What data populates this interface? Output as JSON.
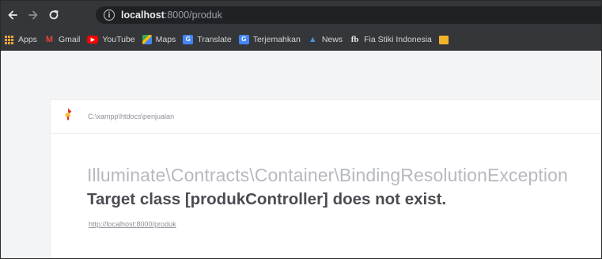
{
  "browser": {
    "url_host": "localhost",
    "url_rest": ":8000/produk",
    "bookmarks": [
      {
        "label": "Apps",
        "icon": "apps-grid-icon"
      },
      {
        "label": "Gmail",
        "icon": "gmail-icon"
      },
      {
        "label": "YouTube",
        "icon": "youtube-icon"
      },
      {
        "label": "Maps",
        "icon": "maps-icon"
      },
      {
        "label": "Translate",
        "icon": "translate-icon"
      },
      {
        "label": "Terjemahkan",
        "icon": "translate-icon"
      },
      {
        "label": "News",
        "icon": "news-icon"
      },
      {
        "label": "Fia Stiki Indonesia",
        "icon": "facebook-icon"
      }
    ]
  },
  "error_page": {
    "file_path": "C:\\xampp\\htdocs\\penjualan",
    "exception_class": "Illuminate\\Contracts\\Container\\BindingResolutionException",
    "message": "Target class [produkController] does not exist.",
    "request_url": "http://localhost:8000/produk"
  },
  "colors": {
    "chrome_bg": "#35363a",
    "omnibox_bg": "#202124",
    "page_bg": "#f3f4f6",
    "card_bg": "#ffffff",
    "exception_class_color": "#b6b9bf",
    "message_color": "#4a4c52",
    "ignition_red": "#e3342f",
    "ignition_yellow": "#f4c430"
  }
}
